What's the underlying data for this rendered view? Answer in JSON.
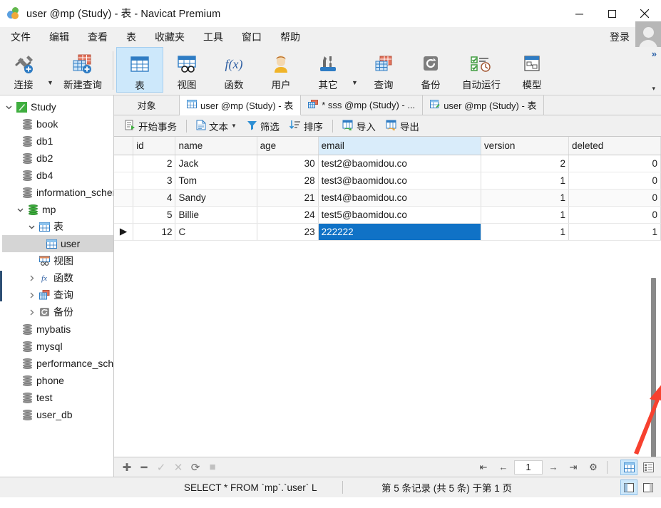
{
  "window": {
    "title": "user @mp (Study) - 表 - Navicat Premium",
    "app_icon": "navicat-logo-icon",
    "minimize": "−",
    "maximize": "□",
    "close": "✕"
  },
  "menubar": {
    "items": [
      "文件",
      "编辑",
      "查看",
      "表",
      "收藏夹",
      "工具",
      "窗口",
      "帮助"
    ],
    "login_label": "登录",
    "avatar": "user-avatar"
  },
  "ribbon": {
    "expand_label": "»",
    "overflow_caret": "▾",
    "buttons": [
      {
        "label": "连接",
        "icon": "connection-icon",
        "has_caret": true,
        "active": false
      },
      {
        "label": "新建查询",
        "icon": "new-query-icon",
        "has_caret": false,
        "active": false
      },
      {
        "label": "表",
        "icon": "table-icon",
        "has_caret": false,
        "active": true
      },
      {
        "label": "视图",
        "icon": "view-icon",
        "has_caret": false,
        "active": false
      },
      {
        "label": "函数",
        "icon": "function-fx-icon",
        "has_caret": false,
        "active": false
      },
      {
        "label": "用户",
        "icon": "user-icon",
        "has_caret": false,
        "active": false
      },
      {
        "label": "其它",
        "icon": "others-tools-icon",
        "has_caret": true,
        "active": false
      },
      {
        "label": "查询",
        "icon": "query-icon",
        "has_caret": false,
        "active": false
      },
      {
        "label": "备份",
        "icon": "backup-icon",
        "has_caret": false,
        "active": false
      },
      {
        "label": "自动运行",
        "icon": "automation-icon",
        "has_caret": false,
        "active": false
      },
      {
        "label": "模型",
        "icon": "model-icon",
        "has_caret": false,
        "active": false
      }
    ]
  },
  "sidebar": {
    "items": [
      {
        "label": "Study",
        "icon": "connection-green-icon",
        "indent": 0,
        "twisty": "down",
        "selected": false
      },
      {
        "label": "book",
        "icon": "database-icon",
        "indent": 1,
        "twisty": "none",
        "selected": false
      },
      {
        "label": "db1",
        "icon": "database-icon",
        "indent": 1,
        "twisty": "none",
        "selected": false
      },
      {
        "label": "db2",
        "icon": "database-icon",
        "indent": 1,
        "twisty": "none",
        "selected": false
      },
      {
        "label": "db4",
        "icon": "database-icon",
        "indent": 1,
        "twisty": "none",
        "selected": false
      },
      {
        "label": "information_schema",
        "icon": "database-icon",
        "indent": 1,
        "twisty": "none",
        "selected": false
      },
      {
        "label": "mp",
        "icon": "database-open-icon",
        "indent": 1,
        "twisty": "down",
        "selected": false
      },
      {
        "label": "表",
        "icon": "table-folder-icon",
        "indent": 2,
        "twisty": "down",
        "selected": false
      },
      {
        "label": "user",
        "icon": "table-icon",
        "indent": 3,
        "twisty": "none",
        "selected": true
      },
      {
        "label": "视图",
        "icon": "view-folder-icon",
        "indent": 2,
        "twisty": "none",
        "selected": false
      },
      {
        "label": "函数",
        "icon": "function-folder-icon",
        "indent": 2,
        "twisty": "right",
        "selected": false
      },
      {
        "label": "查询",
        "icon": "query-folder-icon",
        "indent": 2,
        "twisty": "right",
        "selected": false
      },
      {
        "label": "备份",
        "icon": "backup-folder-icon",
        "indent": 2,
        "twisty": "right",
        "selected": false
      },
      {
        "label": "mybatis",
        "icon": "database-icon",
        "indent": 1,
        "twisty": "none",
        "selected": false
      },
      {
        "label": "mysql",
        "icon": "database-icon",
        "indent": 1,
        "twisty": "none",
        "selected": false
      },
      {
        "label": "performance_schema",
        "icon": "database-icon",
        "indent": 1,
        "twisty": "none",
        "selected": false
      },
      {
        "label": "phone",
        "icon": "database-icon",
        "indent": 1,
        "twisty": "none",
        "selected": false
      },
      {
        "label": "test",
        "icon": "database-icon",
        "indent": 1,
        "twisty": "none",
        "selected": false
      },
      {
        "label": "user_db",
        "icon": "database-icon",
        "indent": 1,
        "twisty": "none",
        "selected": false
      }
    ]
  },
  "tabs": [
    {
      "label": "对象",
      "icon": "none",
      "active": false,
      "kind": "objects"
    },
    {
      "label": "user @mp (Study) - 表",
      "icon": "table-icon",
      "active": true,
      "kind": "table"
    },
    {
      "label": "* sss @mp (Study) - ...",
      "icon": "query-icon",
      "active": false,
      "kind": "query"
    },
    {
      "label": "user @mp (Study) - 表",
      "icon": "table-design-icon",
      "active": false,
      "kind": "design"
    }
  ],
  "grid_toolbar": [
    {
      "label": "开始事务",
      "icon": "begin-transaction-icon",
      "caret": false
    },
    {
      "label": "文本",
      "icon": "text-icon",
      "caret": true
    },
    {
      "label": "筛选",
      "icon": "filter-icon",
      "caret": false
    },
    {
      "label": "排序",
      "icon": "sort-icon",
      "caret": false
    },
    {
      "label": "导入",
      "icon": "import-icon",
      "caret": false
    },
    {
      "label": "导出",
      "icon": "export-icon",
      "caret": false
    }
  ],
  "grid": {
    "columns": [
      "id",
      "name",
      "age",
      "email",
      "version",
      "deleted"
    ],
    "selected_column": "email",
    "rows": [
      {
        "marker": "",
        "id": "2",
        "name": "Jack",
        "age": "30",
        "email": "test2@baomidou.co",
        "version": "2",
        "deleted": "0",
        "current": false,
        "email_selected": false
      },
      {
        "marker": "",
        "id": "3",
        "name": "Tom",
        "age": "28",
        "email": "test3@baomidou.co",
        "version": "1",
        "deleted": "0",
        "current": false,
        "email_selected": false
      },
      {
        "marker": "",
        "id": "4",
        "name": "Sandy",
        "age": "21",
        "email": "test4@baomidou.co",
        "version": "1",
        "deleted": "0",
        "current": false,
        "email_selected": false
      },
      {
        "marker": "",
        "id": "5",
        "name": "Billie",
        "age": "24",
        "email": "test5@baomidou.co",
        "version": "1",
        "deleted": "0",
        "current": false,
        "email_selected": false
      },
      {
        "marker": "▶",
        "id": "12",
        "name": "C",
        "age": "23",
        "email": "222222",
        "version": "1",
        "deleted": "1",
        "current": true,
        "email_selected": true
      }
    ]
  },
  "annotation": {
    "arrow": "red-arrow-pointing-to-deleted-value",
    "color": "#f7412f"
  },
  "bottom_toolbar": {
    "record_buttons": [
      {
        "icon": "add-record-icon",
        "glyph": "✚",
        "enabled": true
      },
      {
        "icon": "delete-record-icon",
        "glyph": "━",
        "enabled": true
      },
      {
        "icon": "apply-change-icon",
        "glyph": "✓",
        "enabled": false
      },
      {
        "icon": "cancel-change-icon",
        "glyph": "✕",
        "enabled": false
      },
      {
        "icon": "refresh-icon",
        "glyph": "⟳",
        "enabled": true
      },
      {
        "icon": "stop-icon",
        "glyph": "■",
        "enabled": false
      }
    ],
    "pager": {
      "first": "⇤",
      "prev": "←",
      "page": "1",
      "next": "→",
      "last": "⇥",
      "settings": "⚙"
    },
    "view_toggle": [
      {
        "icon": "grid-view-icon",
        "active": true
      },
      {
        "icon": "form-view-icon",
        "active": false
      }
    ]
  },
  "statusbar": {
    "sql": "SELECT * FROM `mp`.`user` L",
    "record_info": "第 5 条记录 (共 5 条) 于第 1 页",
    "panel_buttons": [
      {
        "icon": "show-left-panel-icon",
        "active": true
      },
      {
        "icon": "show-right-panel-icon",
        "active": false
      }
    ]
  }
}
